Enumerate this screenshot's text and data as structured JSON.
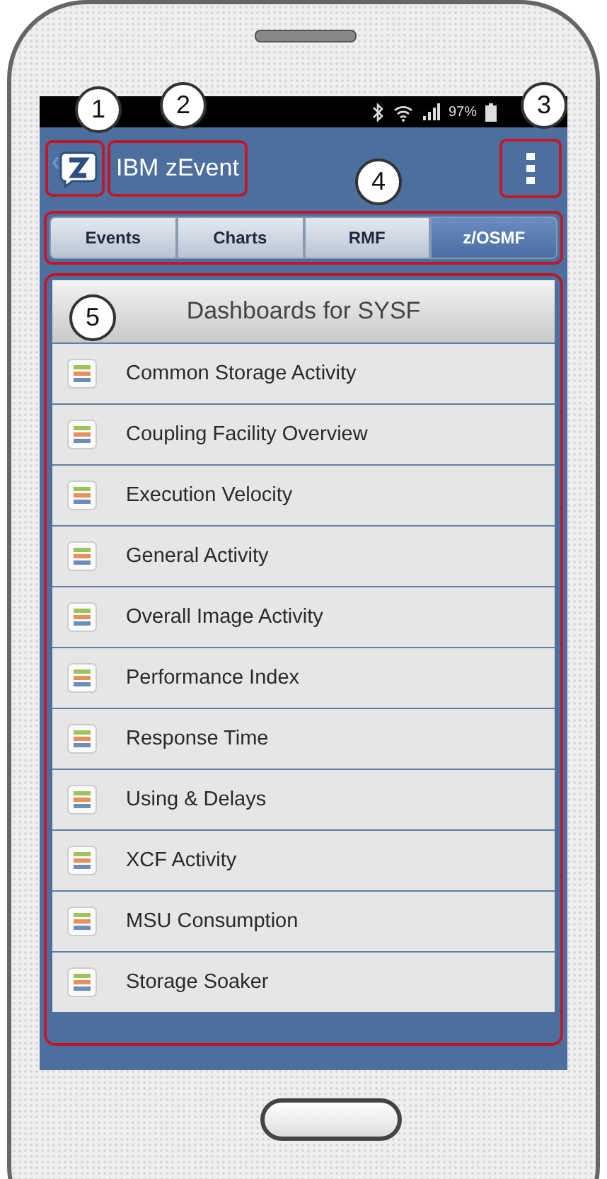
{
  "status_bar": {
    "battery": "97%"
  },
  "app_bar": {
    "title": "IBM zEvent"
  },
  "tabs": [
    {
      "label": "Events",
      "selected": false
    },
    {
      "label": "Charts",
      "selected": false
    },
    {
      "label": "RMF",
      "selected": false
    },
    {
      "label": "z/OSMF",
      "selected": true
    }
  ],
  "panel": {
    "title": "Dashboards for SYSF",
    "items": [
      "Common Storage Activity",
      "Coupling Facility Overview",
      "Execution Velocity",
      "General Activity",
      "Overall Image Activity",
      "Performance Index",
      "Response Time",
      "Using & Delays",
      "XCF Activity",
      "MSU Consumption",
      "Storage Soaker"
    ]
  },
  "callouts": [
    "1",
    "2",
    "3",
    "4",
    "5"
  ]
}
